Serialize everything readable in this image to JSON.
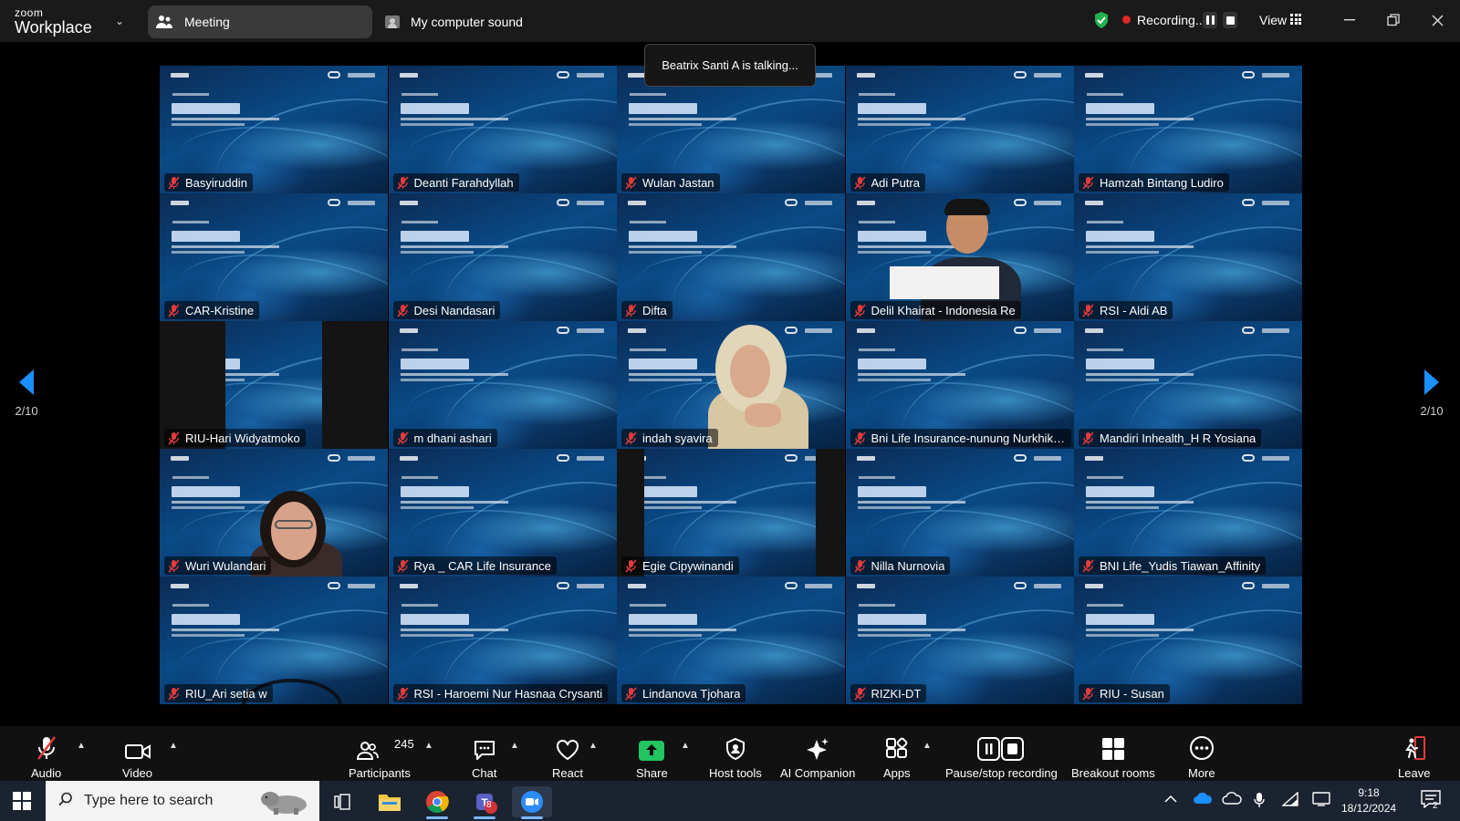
{
  "titlebar": {
    "logo_top": "zoom",
    "logo_bottom": "Workplace",
    "meeting_tab": "Meeting",
    "sound_tab": "My computer sound",
    "recording_label": "Recording...",
    "view_label": "View"
  },
  "banner": {
    "talking": "Beatrix Santi A is talking..."
  },
  "pager": {
    "left": "2/10",
    "right": "2/10"
  },
  "participants": [
    {
      "name": "Basyiruddin"
    },
    {
      "name": "Deanti Farahdyllah"
    },
    {
      "name": "Wulan Jastan"
    },
    {
      "name": "Adi Putra"
    },
    {
      "name": "Hamzah Bintang Ludiro"
    },
    {
      "name": "CAR-Kristine"
    },
    {
      "name": "Desi Nandasari"
    },
    {
      "name": "Difta"
    },
    {
      "name": "Delil Khairat - Indonesia Re"
    },
    {
      "name": "RSI - Aldi AB"
    },
    {
      "name": "RIU-Hari Widyatmoko"
    },
    {
      "name": "m dhani ashari"
    },
    {
      "name": "indah syavira"
    },
    {
      "name": "Bni Life Insurance-nunung Nurkhikm..."
    },
    {
      "name": "Mandiri Inhealth_H R Yosiana"
    },
    {
      "name": "Wuri Wulandari"
    },
    {
      "name": "Rya _ CAR Life Insurance"
    },
    {
      "name": "Egie Cipywinandi"
    },
    {
      "name": "Nilla Nurnovia"
    },
    {
      "name": "BNI Life_Yudis Tiawan_Affinity"
    },
    {
      "name": "RIU_Ari setia w"
    },
    {
      "name": "RSI - Haroemi Nur Hasnaa Crysanti"
    },
    {
      "name": "Lindanova Tjohara"
    },
    {
      "name": "RIZKI-DT"
    },
    {
      "name": "RIU - Susan"
    }
  ],
  "toolbar": {
    "audio": "Audio",
    "video": "Video",
    "participants": "Participants",
    "participants_count": "245",
    "chat": "Chat",
    "react": "React",
    "share": "Share",
    "host_tools": "Host tools",
    "ai_companion": "AI Companion",
    "apps": "Apps",
    "pause_stop_recording": "Pause/stop recording",
    "breakout_rooms": "Breakout rooms",
    "more": "More",
    "leave": "Leave"
  },
  "taskbar": {
    "search_placeholder": "Type here to search",
    "time": "9:18",
    "date": "18/12/2024",
    "teams_badge": "8",
    "notification_count": "2"
  },
  "colors": {
    "accent_blue": "#1a8fff",
    "share_green": "#22c55e",
    "recording_red": "#e02828",
    "muted_red": "#e23b3b"
  }
}
